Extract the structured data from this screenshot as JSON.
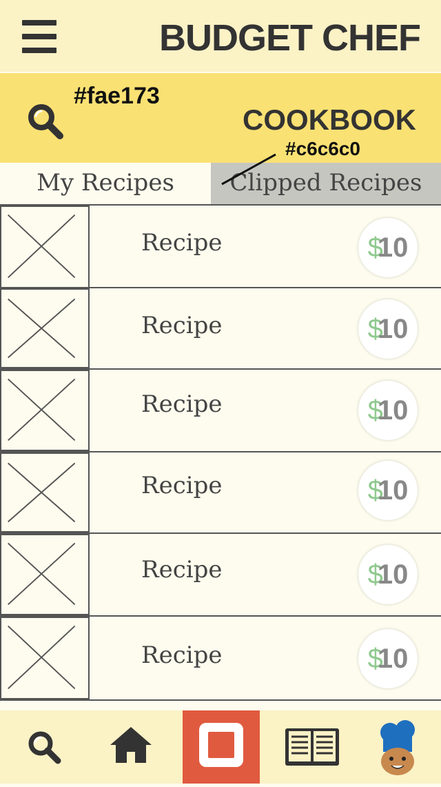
{
  "app": {
    "title": "BUDGET CHEF"
  },
  "section": {
    "title": "COOKBOOK",
    "color_note": "#fae173",
    "header_color": "#fae173"
  },
  "tabs": [
    {
      "label": "My Recipes",
      "active": true
    },
    {
      "label": "Clipped Recipes",
      "active": false
    }
  ],
  "tab_color_note": "#c6c6c0",
  "recipes": [
    {
      "name": "Recipe",
      "currency": "$",
      "price": "10"
    },
    {
      "name": "Recipe",
      "currency": "$",
      "price": "10"
    },
    {
      "name": "Recipe",
      "currency": "$",
      "price": "10"
    },
    {
      "name": "Recipe",
      "currency": "$",
      "price": "10"
    },
    {
      "name": "Recipe",
      "currency": "$",
      "price": "10"
    },
    {
      "name": "Recipe",
      "currency": "$",
      "price": "10"
    }
  ],
  "bottom_nav": {
    "items": [
      {
        "icon": "search-icon"
      },
      {
        "icon": "home-icon"
      },
      {
        "icon": "stop-square-icon",
        "active": true
      },
      {
        "icon": "open-book-icon"
      },
      {
        "icon": "chef-avatar-icon"
      }
    ],
    "active_color": "#e05a3f"
  },
  "colors": {
    "topbar": "#fbf2c6",
    "header": "#fae173",
    "tab_inactive": "#c6c6c0",
    "list_bg": "#fdfcee",
    "price_green": "#8fc98f"
  }
}
